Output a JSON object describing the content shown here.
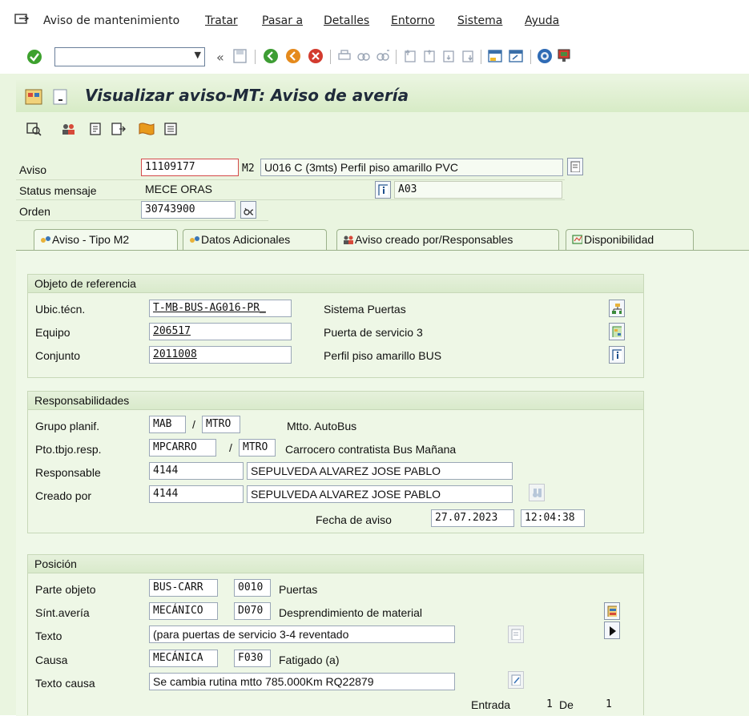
{
  "menubar": {
    "items": [
      {
        "label": "Aviso de mantenimiento",
        "underline": false
      },
      {
        "label": "Tratar"
      },
      {
        "label": "Pasar a"
      },
      {
        "label": "Detalles"
      },
      {
        "label": "Entorno"
      },
      {
        "label": "Sistema"
      },
      {
        "label": "Ayuda"
      }
    ]
  },
  "toolbar": {
    "command_field_value": "",
    "icons": [
      "check-icon",
      "back-icon",
      "save-icon",
      "back-green-icon",
      "exit-icon",
      "cancel-icon",
      "print-icon",
      "find-icon",
      "find-next-icon",
      "first-page-icon",
      "prev-page-icon",
      "next-page-icon",
      "last-page-icon",
      "new-session-icon",
      "shortcut-icon",
      "help-icon",
      "customize-icon"
    ]
  },
  "header": {
    "title": "Visualizar aviso-MT: Aviso de avería"
  },
  "form": {
    "aviso_label": "Aviso",
    "aviso_value": "11109177",
    "aviso_type": "M2",
    "aviso_text": "U016 C (3mts) Perfil piso amarillo PVC",
    "status_label": "Status mensaje",
    "status_value": "MECE ORAS",
    "status_code": "A03",
    "orden_label": "Orden",
    "orden_value": "30743900"
  },
  "tabs": [
    {
      "label": "Aviso - Tipo M2"
    },
    {
      "label": "Datos Adicionales"
    },
    {
      "label": "Aviso creado por/Responsables"
    },
    {
      "label": "Disponibilidad"
    }
  ],
  "objeto": {
    "title": "Objeto de referencia",
    "rows": [
      {
        "label": "Ubic.técn.",
        "value": "T-MB-BUS-AG016-PR_",
        "text": "Sistema Puertas"
      },
      {
        "label": "Equipo",
        "value": "206517",
        "text": "Puerta de servicio 3"
      },
      {
        "label": "Conjunto",
        "value": "2011008",
        "text": "Perfil piso amarillo  BUS"
      }
    ]
  },
  "responsabilidades": {
    "title": "Responsabilidades",
    "grupo_label": "Grupo planif.",
    "grupo_value": "MAB",
    "grupo_slash": "/",
    "grupo_center": "MTRO",
    "grupo_text": "Mtto. AutoBus",
    "pto_label": "Pto.tbjo.resp.",
    "pto_value": "MPCARRO",
    "pto_slash": "/",
    "pto_center": "MTRO",
    "pto_text": "Carrocero contratista Bus Mañana",
    "resp_label": "Responsable",
    "resp_value": "4144",
    "resp_name": "SEPULVEDA ALVAREZ JOSE PABLO",
    "creado_label": "Creado por",
    "creado_value": "4144",
    "creado_name": "SEPULVEDA ALVAREZ JOSE PABLO",
    "fecha_label": "Fecha de aviso",
    "fecha_value": "27.07.2023",
    "hora_value": "12:04:38"
  },
  "posicion": {
    "title": "Posición",
    "parte_label": "Parte objeto",
    "parte_value": "BUS-CARR",
    "parte_code": "0010",
    "parte_text": "Puertas",
    "sint_label": "Sínt.avería",
    "sint_value": "MECÁNICO",
    "sint_code": "D070",
    "sint_text": "Desprendimiento de material",
    "texto_label": "Texto",
    "texto_value": "(para puertas de servicio 3-4 reventado",
    "causa_label": "Causa",
    "causa_value": "MECÁNICA",
    "causa_code": "F030",
    "causa_text": "Fatigado (a)",
    "texto_causa_label": "Texto causa",
    "texto_causa_value": "Se cambia rutina mtto 785.000Km RQ22879",
    "entrada_label": "Entrada",
    "entrada_value": "1",
    "de_label": "De",
    "de_value": "1"
  },
  "colors": {
    "background": "#eaf5e0",
    "title_text": "#1f2a3a",
    "field_border": "#9aa7b7"
  }
}
